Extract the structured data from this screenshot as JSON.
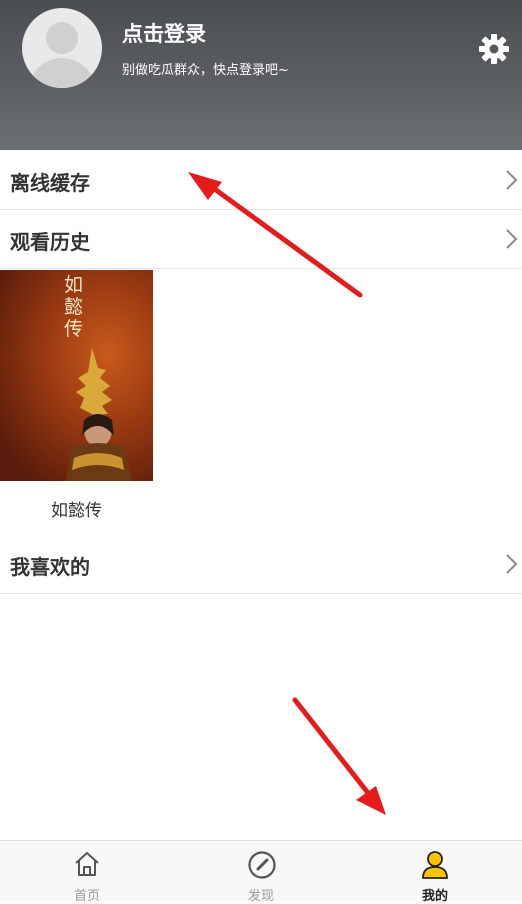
{
  "header": {
    "login_title": "点击登录",
    "login_subtitle": "别做吃瓜群众，快点登录吧~",
    "settings_icon": "gear-icon"
  },
  "menu": {
    "offline_cache": "离线缓存",
    "watch_history": "观看历史",
    "favorites": "我喜欢的"
  },
  "history": {
    "items": [
      {
        "title": "如懿传",
        "poster_text": "如懿传"
      }
    ]
  },
  "tabbar": {
    "tabs": [
      {
        "label": "首页",
        "icon": "home-icon"
      },
      {
        "label": "发现",
        "icon": "discover-icon"
      },
      {
        "label": "我的",
        "icon": "profile-icon",
        "active": true
      }
    ]
  },
  "colors": {
    "header_bg": "#555a5e",
    "accent_yellow": "#f7c600",
    "annotation_red": "#e51c1c"
  }
}
